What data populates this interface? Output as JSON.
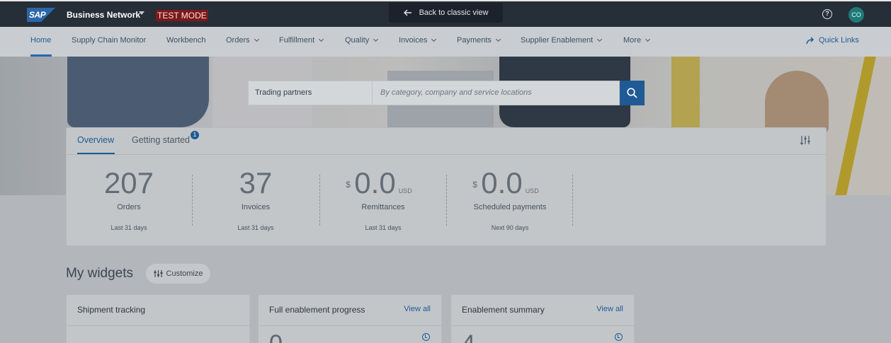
{
  "shell": {
    "brand": "SAP",
    "title": "Business Network",
    "test_mode": "TEST MODE",
    "back_classic": "Back to classic view",
    "avatar_initials": "CO"
  },
  "nav": {
    "items": [
      {
        "label": "Home",
        "dropdown": false
      },
      {
        "label": "Supply Chain Monitor",
        "dropdown": false
      },
      {
        "label": "Workbench",
        "dropdown": false
      },
      {
        "label": "Orders",
        "dropdown": true
      },
      {
        "label": "Fulfillment",
        "dropdown": true
      },
      {
        "label": "Quality",
        "dropdown": true
      },
      {
        "label": "Invoices",
        "dropdown": true
      },
      {
        "label": "Payments",
        "dropdown": true
      },
      {
        "label": "Supplier Enablement",
        "dropdown": true
      },
      {
        "label": "More",
        "dropdown": true
      }
    ],
    "quick_links": "Quick Links"
  },
  "search": {
    "scope": "Trading partners",
    "placeholder": "By category, company and service locations"
  },
  "overview": {
    "tabs": [
      "Overview",
      "Getting started"
    ],
    "getting_started_badge": "1",
    "metrics": [
      {
        "value": "207",
        "currency": "",
        "unit": "",
        "label": "Orders",
        "period": "Last 31 days"
      },
      {
        "value": "37",
        "currency": "",
        "unit": "",
        "label": "Invoices",
        "period": "Last 31 days"
      },
      {
        "value": "0.0",
        "currency": "$",
        "unit": "USD",
        "label": "Remittances",
        "period": "Last 31 days"
      },
      {
        "value": "0.0",
        "currency": "$",
        "unit": "USD",
        "label": "Scheduled payments",
        "period": "Next 90 days"
      }
    ]
  },
  "widgets": {
    "title": "My widgets",
    "customize": "Customize",
    "cards": [
      {
        "title": "Shipment tracking",
        "link": "",
        "value": ""
      },
      {
        "title": "Full enablement progress",
        "link": "View all",
        "value": "0"
      },
      {
        "title": "Enablement summary",
        "link": "View all",
        "value": "4"
      }
    ]
  },
  "colors": {
    "shell": "#262e38",
    "accent": "#1f5a95",
    "test_mode": "#7a1a1a"
  }
}
